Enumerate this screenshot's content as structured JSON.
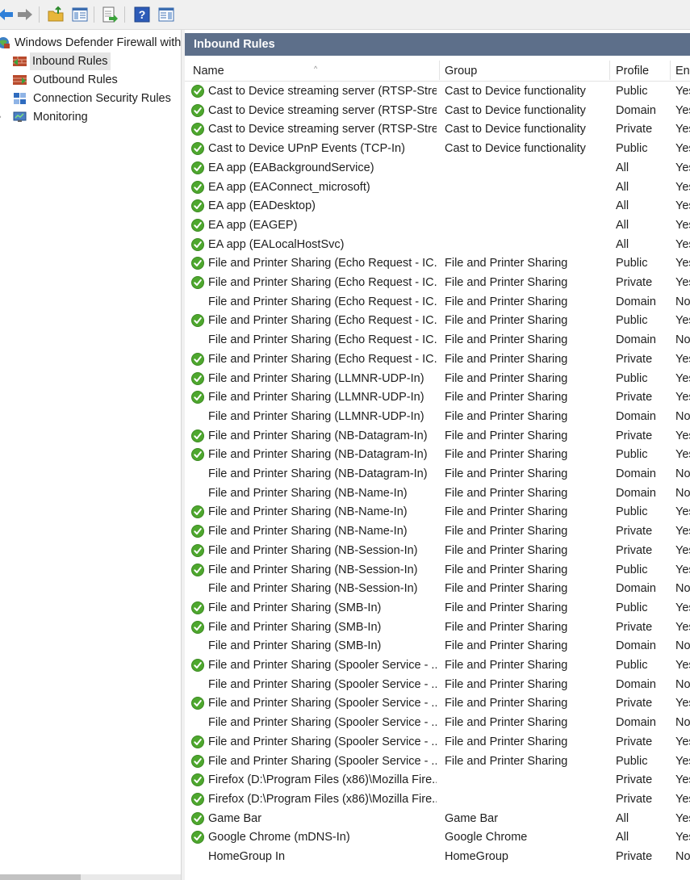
{
  "colors": {
    "pane_title_bg": "#5d6f8a",
    "enabled_check": "#4ea72e",
    "selection": "#e5e5e5"
  },
  "toolbar": {
    "buttons": [
      "back-arrow-icon",
      "forward-arrow-icon",
      "up-folder-icon",
      "show-hide-tree-icon",
      "export-list-icon",
      "help-icon",
      "show-hide-action-pane-icon"
    ]
  },
  "tree": {
    "root": "Windows Defender Firewall with Advanced Security",
    "items": [
      "Inbound Rules",
      "Outbound Rules",
      "Connection Security Rules",
      "Monitoring"
    ],
    "selected": "Inbound Rules"
  },
  "main": {
    "title": "Inbound Rules",
    "columns": {
      "name": "Name",
      "group": "Group",
      "profile": "Profile",
      "enabled": "Enabled"
    },
    "rows": [
      {
        "name": "Cast to Device streaming server (RTSP-Stre...",
        "group": "Cast to Device functionality",
        "profile": "Public",
        "enabled": "Yes",
        "check": true
      },
      {
        "name": "Cast to Device streaming server (RTSP-Stre...",
        "group": "Cast to Device functionality",
        "profile": "Domain",
        "enabled": "Yes",
        "check": true
      },
      {
        "name": "Cast to Device streaming server (RTSP-Stre...",
        "group": "Cast to Device functionality",
        "profile": "Private",
        "enabled": "Yes",
        "check": true
      },
      {
        "name": "Cast to Device UPnP Events (TCP-In)",
        "group": "Cast to Device functionality",
        "profile": "Public",
        "enabled": "Yes",
        "check": true
      },
      {
        "name": "EA app (EABackgroundService)",
        "group": "",
        "profile": "All",
        "enabled": "Yes",
        "check": true
      },
      {
        "name": "EA app (EAConnect_microsoft)",
        "group": "",
        "profile": "All",
        "enabled": "Yes",
        "check": true
      },
      {
        "name": "EA app (EADesktop)",
        "group": "",
        "profile": "All",
        "enabled": "Yes",
        "check": true
      },
      {
        "name": "EA app (EAGEP)",
        "group": "",
        "profile": "All",
        "enabled": "Yes",
        "check": true
      },
      {
        "name": "EA app (EALocalHostSvc)",
        "group": "",
        "profile": "All",
        "enabled": "Yes",
        "check": true
      },
      {
        "name": "File and Printer Sharing (Echo Request - IC...",
        "group": "File and Printer Sharing",
        "profile": "Public",
        "enabled": "Yes",
        "check": true
      },
      {
        "name": "File and Printer Sharing (Echo Request - IC...",
        "group": "File and Printer Sharing",
        "profile": "Private",
        "enabled": "Yes",
        "check": true
      },
      {
        "name": "File and Printer Sharing (Echo Request - IC...",
        "group": "File and Printer Sharing",
        "profile": "Domain",
        "enabled": "No",
        "check": false
      },
      {
        "name": "File and Printer Sharing (Echo Request - IC...",
        "group": "File and Printer Sharing",
        "profile": "Public",
        "enabled": "Yes",
        "check": true
      },
      {
        "name": "File and Printer Sharing (Echo Request - IC...",
        "group": "File and Printer Sharing",
        "profile": "Domain",
        "enabled": "No",
        "check": false
      },
      {
        "name": "File and Printer Sharing (Echo Request - IC...",
        "group": "File and Printer Sharing",
        "profile": "Private",
        "enabled": "Yes",
        "check": true
      },
      {
        "name": "File and Printer Sharing (LLMNR-UDP-In)",
        "group": "File and Printer Sharing",
        "profile": "Public",
        "enabled": "Yes",
        "check": true
      },
      {
        "name": "File and Printer Sharing (LLMNR-UDP-In)",
        "group": "File and Printer Sharing",
        "profile": "Private",
        "enabled": "Yes",
        "check": true
      },
      {
        "name": "File and Printer Sharing (LLMNR-UDP-In)",
        "group": "File and Printer Sharing",
        "profile": "Domain",
        "enabled": "No",
        "check": false
      },
      {
        "name": "File and Printer Sharing (NB-Datagram-In)",
        "group": "File and Printer Sharing",
        "profile": "Private",
        "enabled": "Yes",
        "check": true
      },
      {
        "name": "File and Printer Sharing (NB-Datagram-In)",
        "group": "File and Printer Sharing",
        "profile": "Public",
        "enabled": "Yes",
        "check": true
      },
      {
        "name": "File and Printer Sharing (NB-Datagram-In)",
        "group": "File and Printer Sharing",
        "profile": "Domain",
        "enabled": "No",
        "check": false
      },
      {
        "name": "File and Printer Sharing (NB-Name-In)",
        "group": "File and Printer Sharing",
        "profile": "Domain",
        "enabled": "No",
        "check": false
      },
      {
        "name": "File and Printer Sharing (NB-Name-In)",
        "group": "File and Printer Sharing",
        "profile": "Public",
        "enabled": "Yes",
        "check": true
      },
      {
        "name": "File and Printer Sharing (NB-Name-In)",
        "group": "File and Printer Sharing",
        "profile": "Private",
        "enabled": "Yes",
        "check": true
      },
      {
        "name": "File and Printer Sharing (NB-Session-In)",
        "group": "File and Printer Sharing",
        "profile": "Private",
        "enabled": "Yes",
        "check": true
      },
      {
        "name": "File and Printer Sharing (NB-Session-In)",
        "group": "File and Printer Sharing",
        "profile": "Public",
        "enabled": "Yes",
        "check": true
      },
      {
        "name": "File and Printer Sharing (NB-Session-In)",
        "group": "File and Printer Sharing",
        "profile": "Domain",
        "enabled": "No",
        "check": false
      },
      {
        "name": "File and Printer Sharing (SMB-In)",
        "group": "File and Printer Sharing",
        "profile": "Public",
        "enabled": "Yes",
        "check": true
      },
      {
        "name": "File and Printer Sharing (SMB-In)",
        "group": "File and Printer Sharing",
        "profile": "Private",
        "enabled": "Yes",
        "check": true
      },
      {
        "name": "File and Printer Sharing (SMB-In)",
        "group": "File and Printer Sharing",
        "profile": "Domain",
        "enabled": "No",
        "check": false
      },
      {
        "name": "File and Printer Sharing (Spooler Service - ...",
        "group": "File and Printer Sharing",
        "profile": "Public",
        "enabled": "Yes",
        "check": true
      },
      {
        "name": "File and Printer Sharing (Spooler Service - ...",
        "group": "File and Printer Sharing",
        "profile": "Domain",
        "enabled": "No",
        "check": false
      },
      {
        "name": "File and Printer Sharing (Spooler Service - ...",
        "group": "File and Printer Sharing",
        "profile": "Private",
        "enabled": "Yes",
        "check": true
      },
      {
        "name": "File and Printer Sharing (Spooler Service - ...",
        "group": "File and Printer Sharing",
        "profile": "Domain",
        "enabled": "No",
        "check": false
      },
      {
        "name": "File and Printer Sharing (Spooler Service - ...",
        "group": "File and Printer Sharing",
        "profile": "Private",
        "enabled": "Yes",
        "check": true
      },
      {
        "name": "File and Printer Sharing (Spooler Service - ...",
        "group": "File and Printer Sharing",
        "profile": "Public",
        "enabled": "Yes",
        "check": true
      },
      {
        "name": "Firefox (D:\\Program Files (x86)\\Mozilla Fire...",
        "group": "",
        "profile": "Private",
        "enabled": "Yes",
        "check": true
      },
      {
        "name": "Firefox (D:\\Program Files (x86)\\Mozilla Fire...",
        "group": "",
        "profile": "Private",
        "enabled": "Yes",
        "check": true
      },
      {
        "name": "Game Bar",
        "group": "Game Bar",
        "profile": "All",
        "enabled": "Yes",
        "check": true
      },
      {
        "name": "Google Chrome (mDNS-In)",
        "group": "Google Chrome",
        "profile": "All",
        "enabled": "Yes",
        "check": true
      },
      {
        "name": "HomeGroup In",
        "group": "HomeGroup",
        "profile": "Private",
        "enabled": "No",
        "check": false
      }
    ]
  }
}
